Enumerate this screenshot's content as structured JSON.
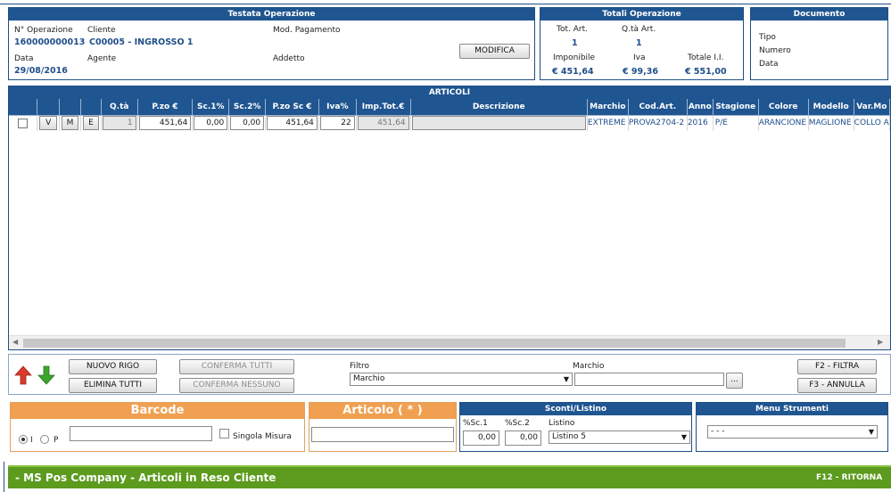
{
  "testata": {
    "title": "Testata Operazione",
    "n_operazione_label": "N° Operazione",
    "n_operazione": "160000000013",
    "cliente_label": "Cliente",
    "cliente": "C00005 - INGROSSO 1",
    "mod_pagamento_label": "Mod. Pagamento",
    "data_label": "Data",
    "data": "29/08/2016",
    "agente_label": "Agente",
    "addetto_label": "Addetto",
    "modifica_label": "MODIFICA"
  },
  "totali": {
    "title": "Totali Operazione",
    "tot_art_label": "Tot. Art.",
    "tot_art": "1",
    "qta_art_label": "Q.tà Art.",
    "qta_art": "1",
    "imponibile_label": "Imponibile",
    "imponibile": "€ 451,64",
    "iva_label": "Iva",
    "iva": "€ 99,36",
    "totale_label": "Totale I.I.",
    "totale": "€ 551,00"
  },
  "documento": {
    "title": "Documento",
    "tipo_label": "Tipo",
    "numero_label": "Numero",
    "data_label": "Data"
  },
  "articoli": {
    "title": "ARTICOLI",
    "columns": [
      "Q.tà",
      "P.zo €",
      "Sc.1%",
      "Sc.2%",
      "P.zo Sc €",
      "Iva%",
      "Imp.Tot.€",
      "Descrizione",
      "Marchio",
      "Cod.Art.",
      "Anno",
      "Stagione",
      "Colore",
      "Modello",
      "Var.Mo"
    ],
    "row": {
      "btn_v": "V",
      "btn_m": "M",
      "btn_e": "E",
      "qta": "1",
      "prezzo": "451,64",
      "sc1": "0,00",
      "sc2": "0,00",
      "prezzo_sc": "451,64",
      "iva": "22",
      "imp_tot": "451,64",
      "descrizione": "",
      "marchio": "EXTREME",
      "cod_art": "PROVA2704-2",
      "anno": "2016",
      "stagione": "P/E",
      "colore": "ARANCIONE",
      "modello": "MAGLIONE",
      "var_mo": "COLLO A"
    }
  },
  "toolbar": {
    "nuovo_rigo": "NUOVO RIGO",
    "elimina_tutti": "ELIMINA TUTTI",
    "conferma_tutti": "CONFERMA TUTTI",
    "conferma_nessuno": "CONFERMA NESSUNO",
    "filtro_label": "Filtro",
    "filtro_value": "Marchio",
    "marchio_label": "Marchio",
    "marchio_value": "",
    "browse_label": "...",
    "f2_label": "F2 - FILTRA",
    "f3_label": "F3 - ANNULLA"
  },
  "barcode": {
    "title": "Barcode",
    "radio_i": "I",
    "radio_p": "P",
    "value": "",
    "singola_misura_label": "Singola Misura"
  },
  "articolo": {
    "title": "Articolo ( * )",
    "value": ""
  },
  "sconti": {
    "title": "Sconti/Listino",
    "sc1_label": "%Sc.1",
    "sc1": "0,00",
    "sc2_label": "%Sc.2",
    "sc2": "0,00",
    "listino_label": "Listino",
    "listino": "Listino 5"
  },
  "menu_strumenti": {
    "title": "Menu Strumenti",
    "value": "- - -"
  },
  "footer": {
    "title": "- MS Pos Company - Articoli in Reso Cliente",
    "shortcut": "F12 - RITORNA"
  },
  "colors": {
    "header_blue": "#1f5590",
    "value_blue": "#1f4f8b",
    "orange": "#f0a050",
    "footer_green": "#5c9b1e",
    "arrow_up": "#d93a2b",
    "arrow_down": "#3aa52a"
  }
}
